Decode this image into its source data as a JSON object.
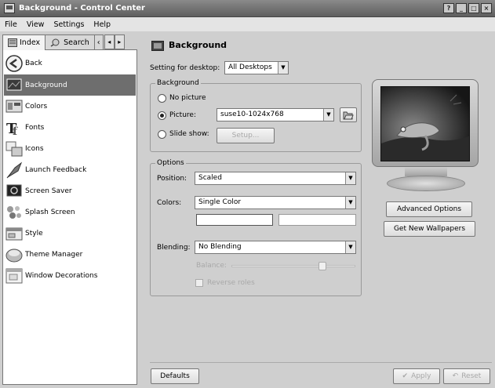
{
  "window": {
    "title": "Background - Control Center",
    "buttons": [
      "?",
      "_",
      "□",
      "×"
    ]
  },
  "menu": [
    {
      "label": "File",
      "underline": "F"
    },
    {
      "label": "View",
      "underline": "V"
    },
    {
      "label": "Settings",
      "underline": "S"
    },
    {
      "label": "Help",
      "underline": "H"
    }
  ],
  "sidebar": {
    "tabs": [
      {
        "label": "Index",
        "icon": "index-icon",
        "active": true
      },
      {
        "label": "Search",
        "icon": "search-icon",
        "active": false
      }
    ],
    "items": [
      {
        "label": "Back",
        "icon": "back-arrow-icon"
      },
      {
        "label": "Background",
        "icon": "background-icon",
        "selected": true
      },
      {
        "label": "Colors",
        "icon": "colors-icon"
      },
      {
        "label": "Fonts",
        "icon": "fonts-icon"
      },
      {
        "label": "Icons",
        "icon": "icons-icon"
      },
      {
        "label": "Launch Feedback",
        "icon": "launch-feedback-icon"
      },
      {
        "label": "Screen Saver",
        "icon": "screen-saver-icon"
      },
      {
        "label": "Splash Screen",
        "icon": "splash-screen-icon"
      },
      {
        "label": "Style",
        "icon": "style-icon"
      },
      {
        "label": "Theme Manager",
        "icon": "theme-manager-icon"
      },
      {
        "label": "Window Decorations",
        "icon": "window-decorations-icon"
      }
    ]
  },
  "page": {
    "title": "Background",
    "desktop_label": "Setting for desktop:",
    "desktop_value": "All Desktops"
  },
  "background_group": {
    "title": "Background",
    "no_picture": "No picture",
    "picture": "Picture:",
    "picture_value": "suse10-1024x768",
    "slide_show": "Slide show:",
    "setup_button": "Setup..."
  },
  "options_group": {
    "title": "Options",
    "position_label": "Position:",
    "position_value": "Scaled",
    "colors_label": "Colors:",
    "colors_value": "Single Color",
    "blending_label": "Blending:",
    "blending_value": "No Blending",
    "balance_label": "Balance:",
    "balance_level": 0.75,
    "reverse_roles": "Reverse roles"
  },
  "actions": {
    "advanced_options": "Advanced Options",
    "get_new_wallpapers": "Get New Wallpapers",
    "defaults": "Defaults",
    "apply": "Apply",
    "reset": "Reset"
  }
}
